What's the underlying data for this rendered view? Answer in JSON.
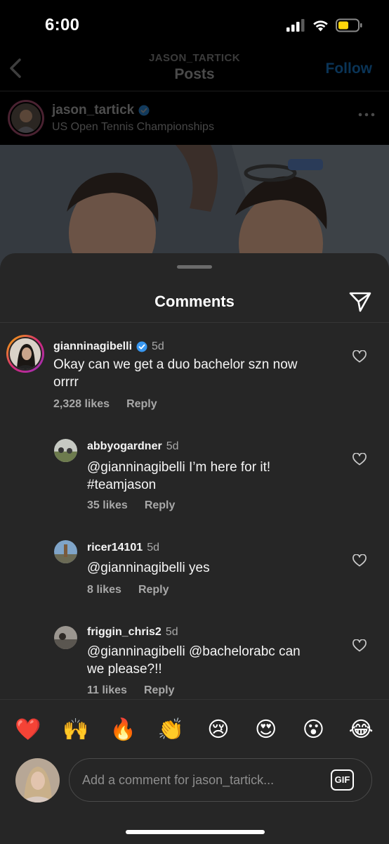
{
  "status_bar": {
    "time": "6:00"
  },
  "background_post": {
    "nav_username": "JASON_TARTICK",
    "nav_title": "Posts",
    "follow_label": "Follow",
    "post_username": "jason_tartick",
    "post_location": "US Open Tennis Championships"
  },
  "sheet": {
    "title": "Comments",
    "comments": [
      {
        "username": "gianninagibelli",
        "verified": true,
        "age": "5d",
        "text": "Okay can we get a duo bachelor szn now\norrrr",
        "likes": "2,328 likes",
        "reply_label": "Reply"
      },
      {
        "username": "abbyogardner",
        "age": "5d",
        "text": "@gianninagibelli I’m here for it!\n#teamjason",
        "likes": "35 likes",
        "reply_label": "Reply"
      },
      {
        "username": "ricer14101",
        "age": "5d",
        "text": "@gianninagibelli yes",
        "likes": "8 likes",
        "reply_label": "Reply"
      },
      {
        "username": "friggin_chris2",
        "age": "5d",
        "text": "@gianninagibelli @bachelorabc can\nwe please?!!",
        "likes": "11 likes",
        "reply_label": "Reply"
      }
    ],
    "emojis": [
      "❤️",
      "🙌",
      "🔥",
      "👏",
      "😢",
      "😍",
      "😮",
      "😂"
    ],
    "composer": {
      "placeholder": "Add a comment for jason_tartick...",
      "gif_label": "GIF"
    }
  },
  "colors": {
    "sheet_bg": "#262626",
    "verified_blue": "#3897f0",
    "follow_blue_dimmed": "#0a3457",
    "secondary_text": "#a8a8a8"
  }
}
